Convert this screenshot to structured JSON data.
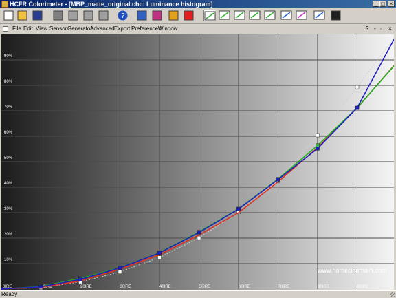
{
  "window": {
    "title": "HCFR Colorimeter - [MBP_matte_original.chc: Luminance histogram]",
    "controls": [
      "_",
      "□",
      "×"
    ]
  },
  "toolbar": {
    "buttons": [
      {
        "name": "new-file-icon",
        "color": "#ffffff"
      },
      {
        "name": "open-folder-icon",
        "color": "#f0c040"
      },
      {
        "name": "save-icon",
        "color": "#2a3c90"
      },
      {
        "name": "cut-icon",
        "color": "#808080"
      },
      {
        "name": "copy-icon",
        "color": "#a0a0a0"
      },
      {
        "name": "paste-icon",
        "color": "#a0a0a0"
      },
      {
        "name": "print-icon",
        "color": "#a0a0a0"
      },
      {
        "name": "help-icon",
        "color": "#2050c0"
      },
      {
        "name": "measures-grid-icon",
        "color": "#3060c0"
      },
      {
        "name": "color-palette-icon",
        "color": "#c03080"
      },
      {
        "name": "color-folder-icon",
        "color": "#e0a020"
      },
      {
        "name": "rgb-histogram-icon",
        "color": "#e02020"
      },
      {
        "name": "luminance-view-icon",
        "color": "#30b030"
      },
      {
        "name": "gamma-view-icon",
        "color": "#30b030"
      },
      {
        "name": "color-temp-view-icon",
        "color": "#30b030"
      },
      {
        "name": "deltae-view-icon",
        "color": "#30b030"
      },
      {
        "name": "cie-chart-icon",
        "color": "#30b030"
      },
      {
        "name": "color-cie-view-icon",
        "color": "#2060d0"
      },
      {
        "name": "rgb-levels-view-icon",
        "color": "#c030c0"
      },
      {
        "name": "saturation-view-icon",
        "color": "#2060d0"
      },
      {
        "name": "film-strip-icon",
        "color": "#202020"
      }
    ],
    "selected_index": 12
  },
  "menubar": {
    "items": [
      "File",
      "Edit",
      "View",
      "Sensor",
      "Generator",
      "Advanced",
      "Export",
      "Preferences",
      "Window"
    ],
    "right_items": [
      "?",
      "-",
      "▫",
      "×"
    ]
  },
  "chart_data": {
    "type": "line",
    "x": [
      0,
      10,
      20,
      30,
      40,
      50,
      60,
      70,
      80,
      90,
      100
    ],
    "x_tick_labels": [
      "0IRE",
      "10IRE",
      "20IRE",
      "30IRE",
      "40IRE",
      "50IRE",
      "60IRE",
      "70IRE",
      "80IRE",
      "90IRE"
    ],
    "y_tick_labels": [
      "10%",
      "20%",
      "30%",
      "40%",
      "50%",
      "60%",
      "70%",
      "80%",
      "90%"
    ],
    "ylim": [
      0,
      100
    ],
    "xlim": [
      0,
      100
    ],
    "grid": true,
    "watermark": "www.homecinema-fr.com",
    "series": [
      {
        "color": "#d0d0d0",
        "dashed": true,
        "marker": "square",
        "marker_color": "#ffffff",
        "values": [
          0.0,
          0.5,
          2.8,
          6.7,
          12.4,
          20.1,
          30.2,
          42.5,
          60.4,
          79.3,
          100.0
        ]
      },
      {
        "color": "#e03020",
        "dashed": false,
        "marker": "none",
        "values": [
          0.0,
          0.7,
          3.2,
          7.8,
          13.5,
          21.2,
          30.0,
          42.1,
          55.6,
          71.1,
          89.0
        ]
      },
      {
        "color": "#20b020",
        "dashed": false,
        "marker": "square",
        "marker_color": "#30c040",
        "values": [
          0.0,
          1.0,
          4.2,
          8.4,
          14.3,
          22.4,
          31.5,
          43.2,
          56.4,
          71.2,
          88.8
        ]
      },
      {
        "color": "#2020c0",
        "dashed": false,
        "marker": "square",
        "marker_color": "#1820c8",
        "values": [
          0.0,
          0.9,
          3.8,
          8.3,
          14.2,
          22.2,
          31.4,
          43.0,
          55.2,
          71.2,
          100.0
        ]
      }
    ]
  },
  "statusbar": {
    "text": "Ready"
  }
}
